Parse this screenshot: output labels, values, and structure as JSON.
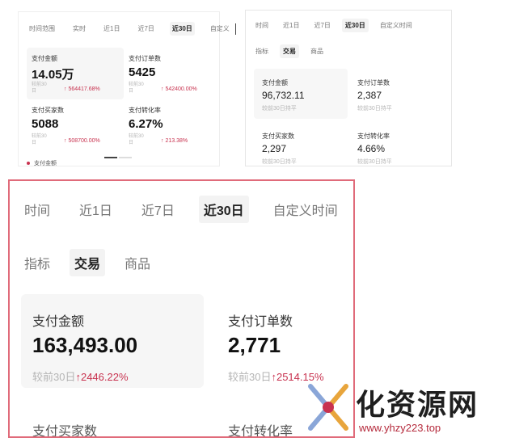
{
  "panel1": {
    "tabs": [
      "时间范围",
      "实时",
      "近1日",
      "近7日",
      "近30日",
      "自定义"
    ],
    "active_tab": 4,
    "cards": [
      {
        "label": "支付金额",
        "value": "14.05万",
        "sub": "较前30日",
        "change": "↑ 564417.68%"
      },
      {
        "label": "支付订单数",
        "value": "5425",
        "sub": "较前30日",
        "change": "↑ 542400.00%"
      },
      {
        "label": "支付买家数",
        "value": "5088",
        "sub": "较前30日",
        "change": "↑ 508700.00%"
      },
      {
        "label": "支付转化率",
        "value": "6.27%",
        "sub": "较前30日",
        "change": "↑ 213.38%"
      }
    ],
    "legend": "支付金额"
  },
  "panel2": {
    "tabs": [
      "时间",
      "近1日",
      "近7日",
      "近30日",
      "自定义时间"
    ],
    "active_tab": 3,
    "subtabs": [
      "指标",
      "交易",
      "商品"
    ],
    "active_subtab": 1,
    "cards": [
      {
        "label": "支付金额",
        "value": "96,732.11",
        "sub": "较前30日持平"
      },
      {
        "label": "支付订单数",
        "value": "2,387",
        "sub": "较前30日持平"
      },
      {
        "label": "支付买家数",
        "value": "2,297",
        "sub": "较前30日持平"
      },
      {
        "label": "支付转化率",
        "value": "4.66%",
        "sub": "较前30日持平"
      }
    ]
  },
  "panel3": {
    "tabs": [
      "时间",
      "近1日",
      "近7日",
      "近30日",
      "自定义时间"
    ],
    "active_tab": 3,
    "subtabs": [
      "指标",
      "交易",
      "商品"
    ],
    "active_subtab": 1,
    "cards": [
      {
        "label": "支付金额",
        "value": "163,493.00",
        "sub": "较前30日",
        "change": "↑2446.22%"
      },
      {
        "label": "支付订单数",
        "value": "2,771",
        "sub": "较前30日",
        "change": "↑2514.15%"
      }
    ],
    "row2": [
      "支付买家数",
      "支付转化率"
    ]
  },
  "watermark": {
    "text": "化资源网",
    "url": "www.yhzy223.top"
  },
  "colors": {
    "accent": "#c8324f",
    "highlight_border": "#e06b7a"
  }
}
